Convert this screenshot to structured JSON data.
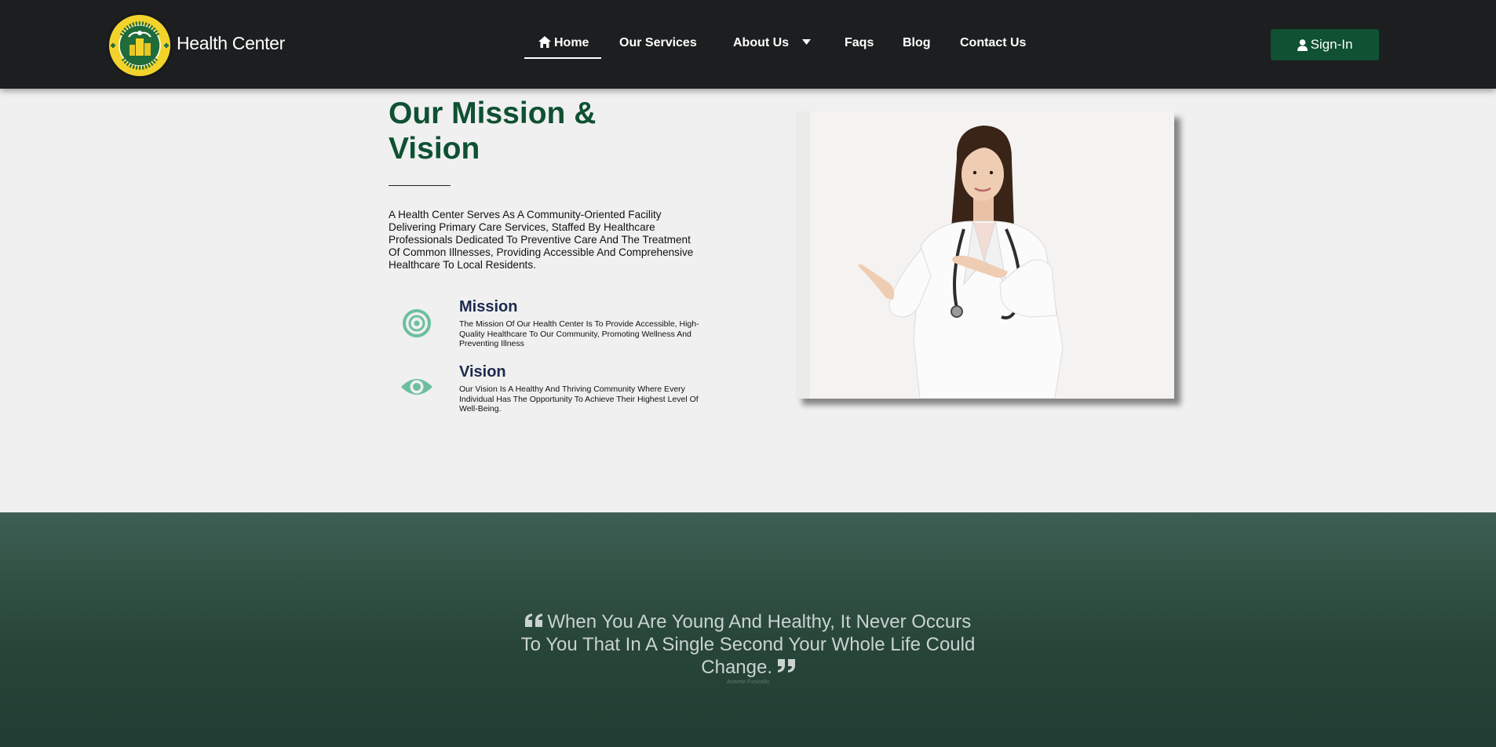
{
  "header": {
    "brand": "Health Center",
    "logo": {
      "ring_text_top": "ANABU II F",
      "ring_text_bottom": "HEALTH CENTER",
      "colors": {
        "ring": "#f2d32c",
        "center": "#1f6b3a"
      }
    },
    "nav": [
      {
        "label": "Home",
        "icon": "home-icon",
        "active": true
      },
      {
        "label": "Our Services"
      },
      {
        "label": "About Us",
        "icon": "caret-down-icon"
      },
      {
        "label": "Faqs"
      },
      {
        "label": "Blog"
      },
      {
        "label": "Contact Us"
      }
    ],
    "signin_label": "Sign-In",
    "signin_icon": "user-icon"
  },
  "mission_section": {
    "title": "Our Mission & Vision",
    "intro": "A Health Center Serves As A Community-Oriented Facility Delivering Primary Care Services, Staffed By Healthcare Professionals Dedicated To Preventive Care And The Treatment Of Common Illnesses, Providing Accessible And Comprehensive Healthcare To Local Residents.",
    "features": [
      {
        "icon": "target-icon",
        "title": "Mission",
        "text": "The Mission Of Our Health Center Is To Provide Accessible, High-Quality Healthcare To Our Community, Promoting Wellness And Preventing Illness"
      },
      {
        "icon": "eye-icon",
        "title": "Vision",
        "text": "Our Vision Is A Healthy And Thriving Community Where Every Individual Has The Opportunity To Achieve Their Highest Level Of Well-Being."
      }
    ],
    "photo": "doctor-pointing-image"
  },
  "quote_section": {
    "quote": "When You Are Young And Healthy, It Never Occurs To You That In A Single Second Your Whole Life Could Change.",
    "author": "Annette Funicello",
    "open_icon": "quote-open-icon",
    "close_icon": "quote-close-icon"
  },
  "colors": {
    "header_bg": "#1c1e1f",
    "brand_green": "#0f5132",
    "icon_teal": "#6cbf9f",
    "heading_navy": "#1b2a4e",
    "quote_band": "#2b4a3e"
  }
}
